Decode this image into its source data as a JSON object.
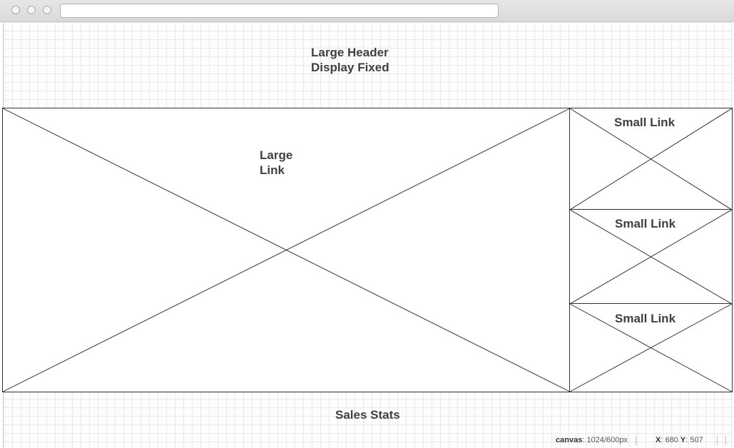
{
  "browser": {
    "url": ""
  },
  "page": {
    "header_title": "Large Header\nDisplay Fixed",
    "large_link_label": "Large\nLink",
    "small_links": [
      {
        "label": "Small Link"
      },
      {
        "label": "Small Link"
      },
      {
        "label": "Small Link"
      }
    ],
    "sales_stats_label": "Sales Stats"
  },
  "status_bar": {
    "canvas_key": "canvas",
    "canvas_value": "1024/600px",
    "x_key": "X",
    "x_value": "680",
    "y_key": "Y",
    "y_value": "507"
  },
  "colors": {
    "placeholder_stroke": "#333333",
    "label_text": "#404040"
  }
}
